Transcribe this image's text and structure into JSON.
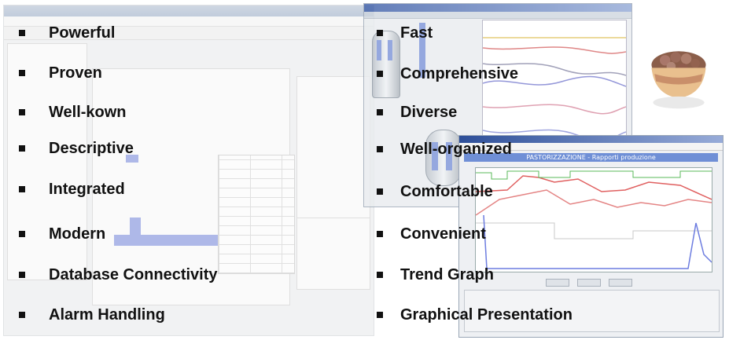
{
  "background": {
    "left_window": "faded software editor window",
    "right_top_window": "trend monitoring window",
    "right_bottom_window": {
      "header": "PASTORIZZAZIONE - Rapporti produzione"
    },
    "decor": "dessert-cup-image"
  },
  "features": {
    "left": [
      "Powerful",
      "Proven",
      "Well-kown",
      "Descriptive",
      "Integrated",
      "Modern",
      "Database Connectivity",
      "Alarm Handling"
    ],
    "right": [
      "Fast",
      "Comprehensive",
      "Diverse",
      "Well-organized",
      "Comfortable",
      "Convenient",
      "Trend Graph",
      "Graphical Presentation"
    ]
  },
  "colors": {
    "bullet": "#111111",
    "text": "#111111",
    "window_accent": "#6f8fd6"
  }
}
